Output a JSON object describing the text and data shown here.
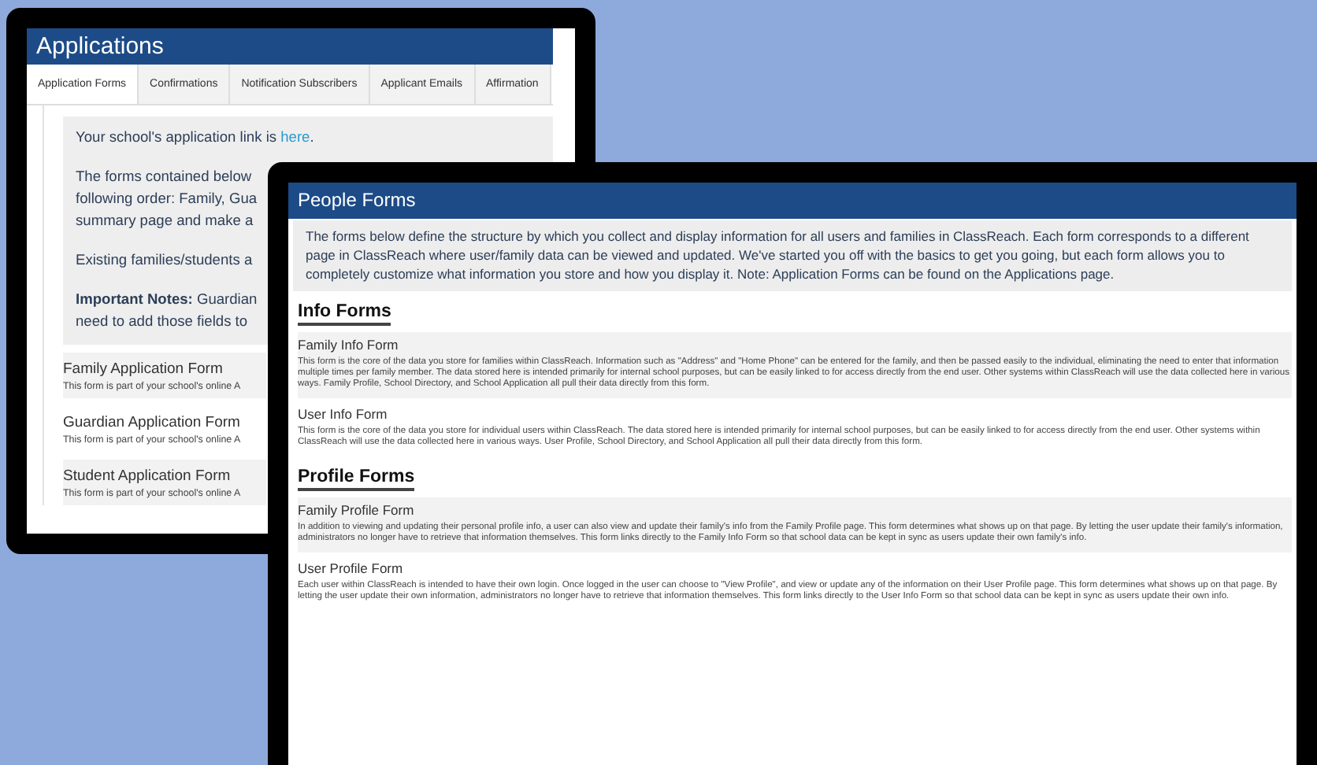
{
  "applications_window": {
    "title": "Applications",
    "tabs": [
      {
        "label": "Application Forms",
        "selected": true
      },
      {
        "label": "Confirmations",
        "selected": false
      },
      {
        "label": "Notification Subscribers",
        "selected": false
      },
      {
        "label": "Applicant Emails",
        "selected": false
      },
      {
        "label": "Affirmation",
        "selected": false
      }
    ],
    "notice": {
      "link_line": {
        "text": "Your school's application link is ",
        "link": "here",
        "after": "."
      },
      "paragraphs": [
        [
          "The forms contained below",
          "following order: Family, Gua",
          "summary page and make a"
        ],
        [
          "Existing families/students a"
        ],
        [
          "**Important Notes:** Guardian",
          "need to add those fields to"
        ]
      ]
    },
    "forms": [
      {
        "title": "Family Application Form",
        "description": "This form is part of your school's online A"
      },
      {
        "title": "Guardian Application Form",
        "description": "This form is part of your school's online A"
      },
      {
        "title": "Student Application Form",
        "description": "This form is part of your school's online A"
      }
    ]
  },
  "people_forms_window": {
    "title": "People Forms",
    "intro": "The forms below define the structure by which you collect and display information for all users and families in ClassReach. Each form corresponds to a different page in ClassReach where user/family data can be viewed and updated. We've started you off with the basics to get you going, but each form allows you to completely customize what information you store and how you display it. Note: Application Forms can be found on the Applications page.",
    "sections": [
      {
        "heading": "Info Forms",
        "forms": [
          {
            "title": "Family Info Form",
            "description": "This form is the core of the data you store for families within ClassReach. Information such as \"Address\" and \"Home Phone\" can be entered for the family, and then be passed easily to the individual, eliminating the need to enter that information multiple times per family member. The data stored here is intended primarily for internal school purposes, but can be easily linked to for access directly from the end user. Other systems within ClassReach will use the data collected here in various ways. Family Profile, School Directory, and School Application all pull their data directly from this form."
          },
          {
            "title": "User Info Form",
            "description": "This form is the core of the data you store for individual users within ClassReach. The data stored here is intended primarily for internal school purposes, but can be easily linked to for access directly from the end user. Other systems within ClassReach will use the data collected here in various ways. User Profile, School Directory, and School Application all pull their data directly from this form."
          }
        ]
      },
      {
        "heading": "Profile Forms",
        "forms": [
          {
            "title": "Family Profile Form",
            "description": "In addition to viewing and updating their personal profile info, a user can also view and update their family's info from the Family Profile page. This form determines what shows up on that page. By letting the user update their family's information, administrators no longer have to retrieve that information themselves. This form links directly to the Family Info Form so that school data can be kept in sync as users update their own family's info."
          },
          {
            "title": "User Profile Form",
            "description": "Each user within ClassReach is intended to have their own login. Once logged in the user can choose to \"View Profile\", and view or update any of the information on their User Profile page. This form determines what shows up on that page. By letting the user update their own information, administrators no longer have to retrieve that information themselves. This form links directly to the User Info Form so that school data can be kept in sync as users update their own info."
          }
        ]
      }
    ]
  }
}
